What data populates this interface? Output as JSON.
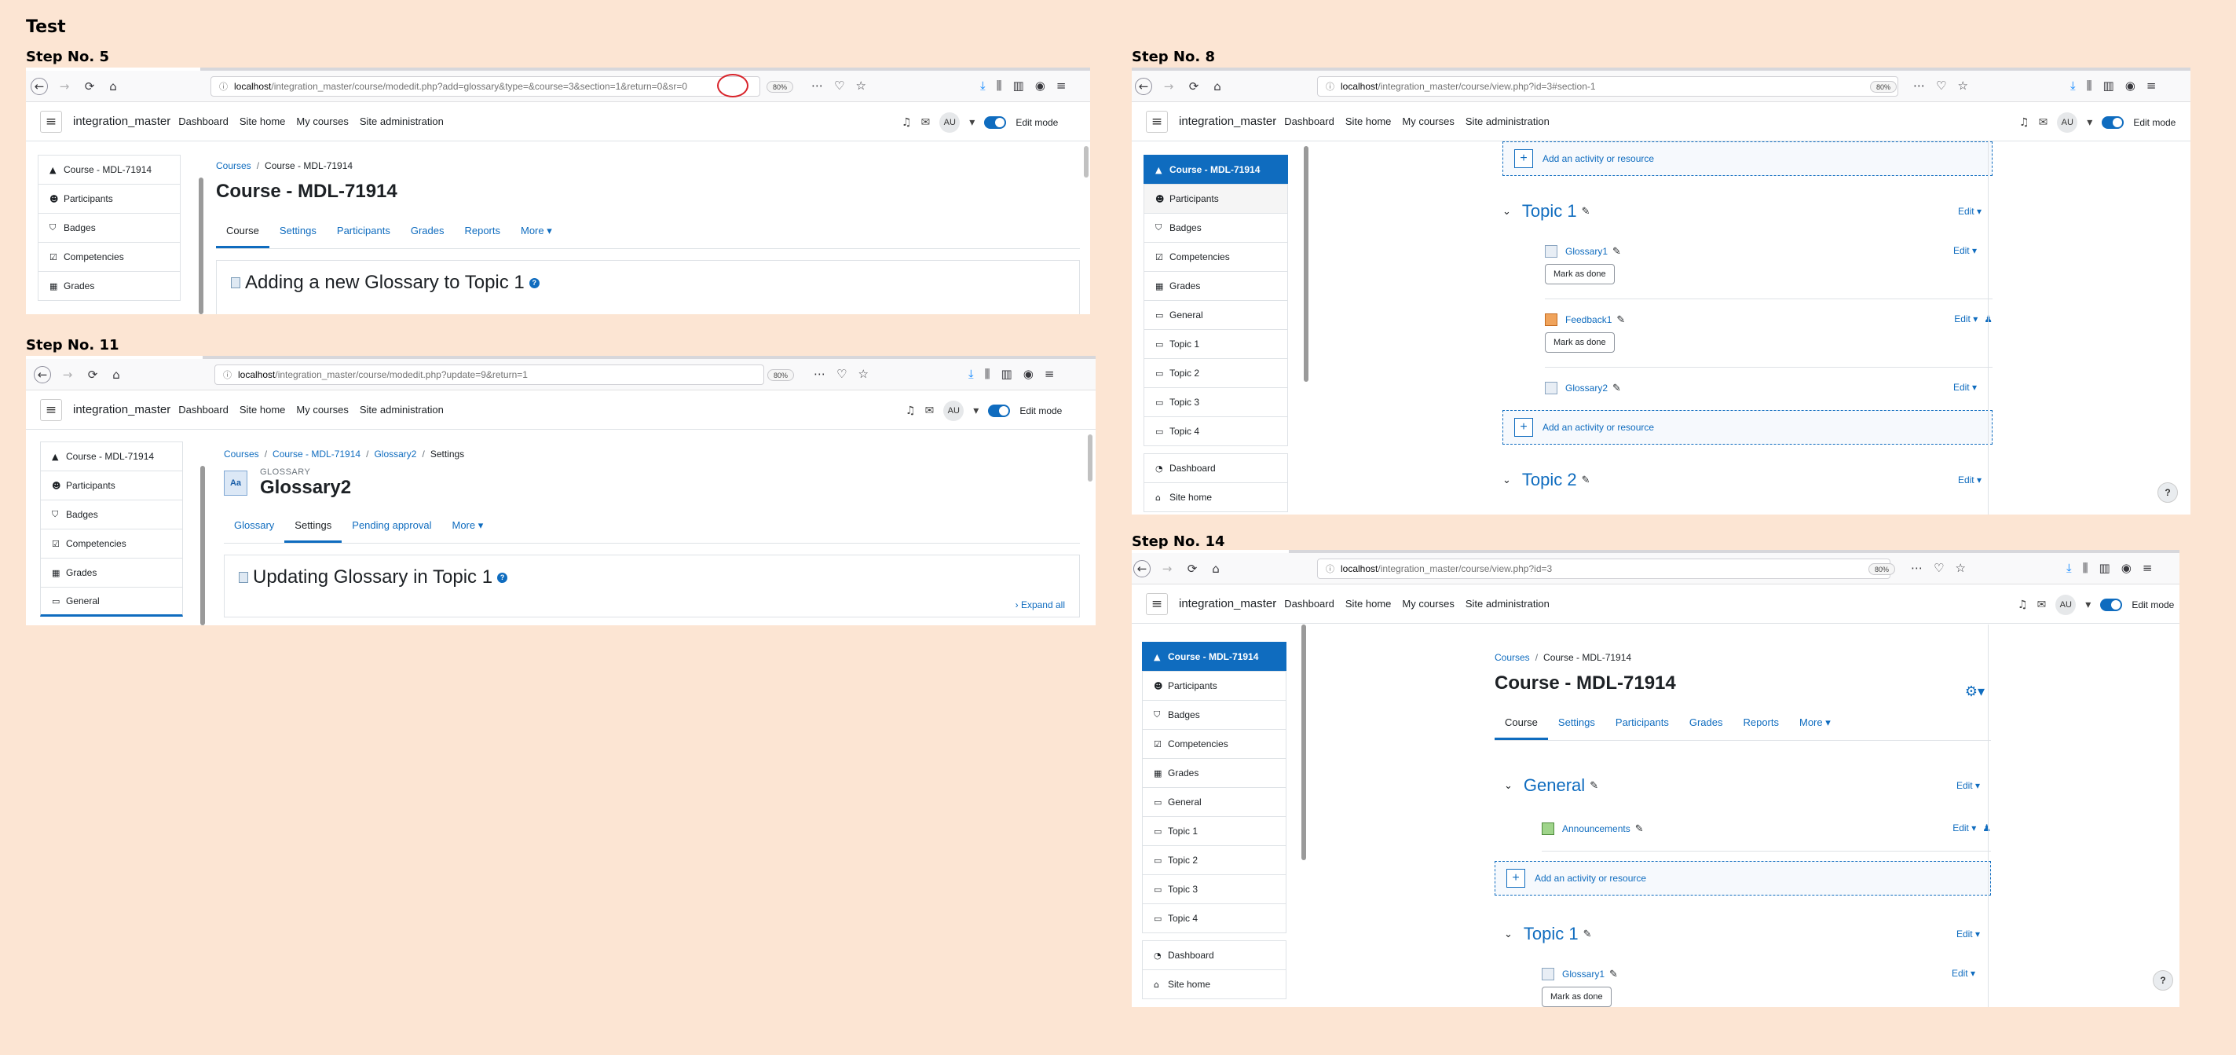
{
  "page_title": "Test",
  "steps": {
    "s5": {
      "label": "Step No. 5",
      "url_host": "localhost",
      "url_rest": "/integration_master/course/modedit.php?add=glossary&type=&course=3&section=1&return=0&sr=0",
      "zoom": "80%",
      "site_name": "integration_master",
      "nav": [
        "Dashboard",
        "Site home",
        "My courses",
        "Site administration"
      ],
      "avatar": "AU",
      "edit_mode": "Edit mode",
      "drawer": [
        "Course - MDL-71914",
        "Participants",
        "Badges",
        "Competencies",
        "Grades"
      ],
      "crumb_root": "Courses",
      "crumb_current": "Course - MDL-71914",
      "heading": "Course - MDL-71914",
      "tabs": [
        "Course",
        "Settings",
        "Participants",
        "Grades",
        "Reports",
        "More ▾"
      ],
      "form_title": "Adding a new Glossary to Topic 1"
    },
    "s11": {
      "label": "Step No. 11",
      "url_host": "localhost",
      "url_rest": "/integration_master/course/modedit.php?update=9&return=1",
      "zoom": "80%",
      "site_name": "integration_master",
      "nav": [
        "Dashboard",
        "Site home",
        "My courses",
        "Site administration"
      ],
      "avatar": "AU",
      "edit_mode": "Edit mode",
      "drawer": [
        "Course - MDL-71914",
        "Participants",
        "Badges",
        "Competencies",
        "Grades",
        "General"
      ],
      "crumbs": [
        "Courses",
        "Course - MDL-71914",
        "Glossary2",
        "Settings"
      ],
      "kicker": "GLOSSARY",
      "heading": "Glossary2",
      "icon_text": "Aa",
      "tabs": [
        "Glossary",
        "Settings",
        "Pending approval",
        "More ▾"
      ],
      "form_title": "Updating Glossary in Topic 1",
      "expand_all": "Expand all"
    },
    "s8": {
      "label": "Step No. 8",
      "url_host": "localhost",
      "url_rest": "/integration_master/course/view.php?id=3#section-1",
      "zoom": "80%",
      "site_name": "integration_master",
      "nav": [
        "Dashboard",
        "Site home",
        "My courses",
        "Site administration"
      ],
      "avatar": "AU",
      "edit_mode": "Edit mode",
      "drawer": [
        "Course - MDL-71914",
        "Participants",
        "Badges",
        "Competencies",
        "Grades",
        "General",
        "Topic 1",
        "Topic 2",
        "Topic 3",
        "Topic 4"
      ],
      "drawer_bottom": [
        "Dashboard",
        "Site home"
      ],
      "add_activity": "Add an activity or resource",
      "topic1": "Topic 1",
      "topic2": "Topic 2",
      "edit": "Edit ▾",
      "activities": [
        "Glossary1",
        "Feedback1",
        "Glossary2"
      ],
      "mark_done": "Mark as done",
      "help": "?"
    },
    "s14": {
      "label": "Step No. 14",
      "url_host": "localhost",
      "url_rest": "/integration_master/course/view.php?id=3",
      "zoom": "80%",
      "site_name": "integration_master",
      "nav": [
        "Dashboard",
        "Site home",
        "My courses",
        "Site administration"
      ],
      "avatar": "AU",
      "edit_mode": "Edit mode",
      "drawer": [
        "Course - MDL-71914",
        "Participants",
        "Badges",
        "Competencies",
        "Grades",
        "General",
        "Topic 1",
        "Topic 2",
        "Topic 3",
        "Topic 4"
      ],
      "drawer_bottom": [
        "Dashboard",
        "Site home"
      ],
      "crumb_root": "Courses",
      "crumb_current": "Course - MDL-71914",
      "heading": "Course - MDL-71914",
      "tabs": [
        "Course",
        "Settings",
        "Participants",
        "Grades",
        "Reports",
        "More ▾"
      ],
      "general": "General",
      "announcements": "Announcements",
      "add_activity": "Add an activity or resource",
      "topic1": "Topic 1",
      "glossary1": "Glossary1",
      "mark_done": "Mark as done",
      "edit": "Edit ▾",
      "help": "?"
    }
  },
  "icons": [
    "back-icon",
    "forward-icon",
    "reload-icon",
    "home-icon",
    "info-icon",
    "overflow-icon",
    "pocket-icon",
    "bookmark-star-icon",
    "download-icon",
    "library-icon",
    "sidebar-icon",
    "account-icon",
    "menu-icon",
    "bell-icon",
    "chat-icon",
    "pencil-icon",
    "person-icon",
    "gear-icon"
  ],
  "colors": {
    "background": "#fce5d3",
    "moodle_blue": "#0f6cbf",
    "annotation_red": "#d8232a"
  }
}
